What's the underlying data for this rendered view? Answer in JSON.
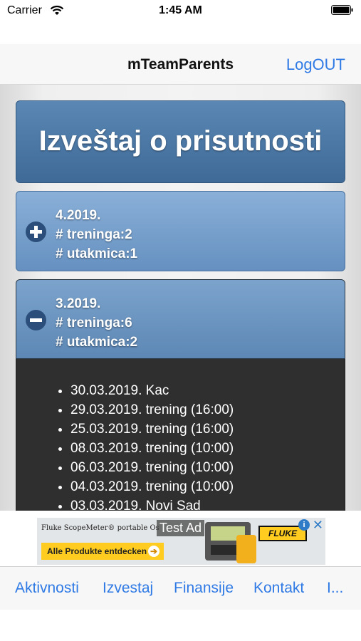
{
  "status_bar": {
    "carrier": "Carrier",
    "time": "1:45 AM"
  },
  "nav": {
    "title": "mTeamParents",
    "logout": "LogOUT"
  },
  "report": {
    "title": "Izveštaj o prisutnosti"
  },
  "months": [
    {
      "period": "4.2019.",
      "trainings": "# treninga:2",
      "matches": "# utakmica:1",
      "expanded": false,
      "icon": "plus-icon"
    },
    {
      "period": "3.2019.",
      "trainings": "# treninga:6",
      "matches": "# utakmica:2",
      "expanded": true,
      "icon": "minus-icon",
      "events": [
        "30.03.2019. Kac",
        "29.03.2019. trening (16:00)",
        "25.03.2019. trening (16:00)",
        "08.03.2019. trening (10:00)",
        "06.03.2019. trening (10:00)",
        "04.03.2019. trening (10:00)",
        "03.03.2019. Novi Sad"
      ]
    }
  ],
  "ad": {
    "brand_line": "Fluke ScopeMeter® portable Os",
    "test_label": "Test Ad",
    "cta": "Alle Produkte entdecken",
    "logo": "FLUKE",
    "info_icon": "i",
    "close_icon": "✕"
  },
  "tabs": [
    "Aktivnosti",
    "Izvestaj",
    "Finansije",
    "Kontakt",
    "I..."
  ],
  "colors": {
    "accent": "#2f7ae5",
    "header_blue": "#4a77a7",
    "list_bg": "#2f2f2f"
  }
}
